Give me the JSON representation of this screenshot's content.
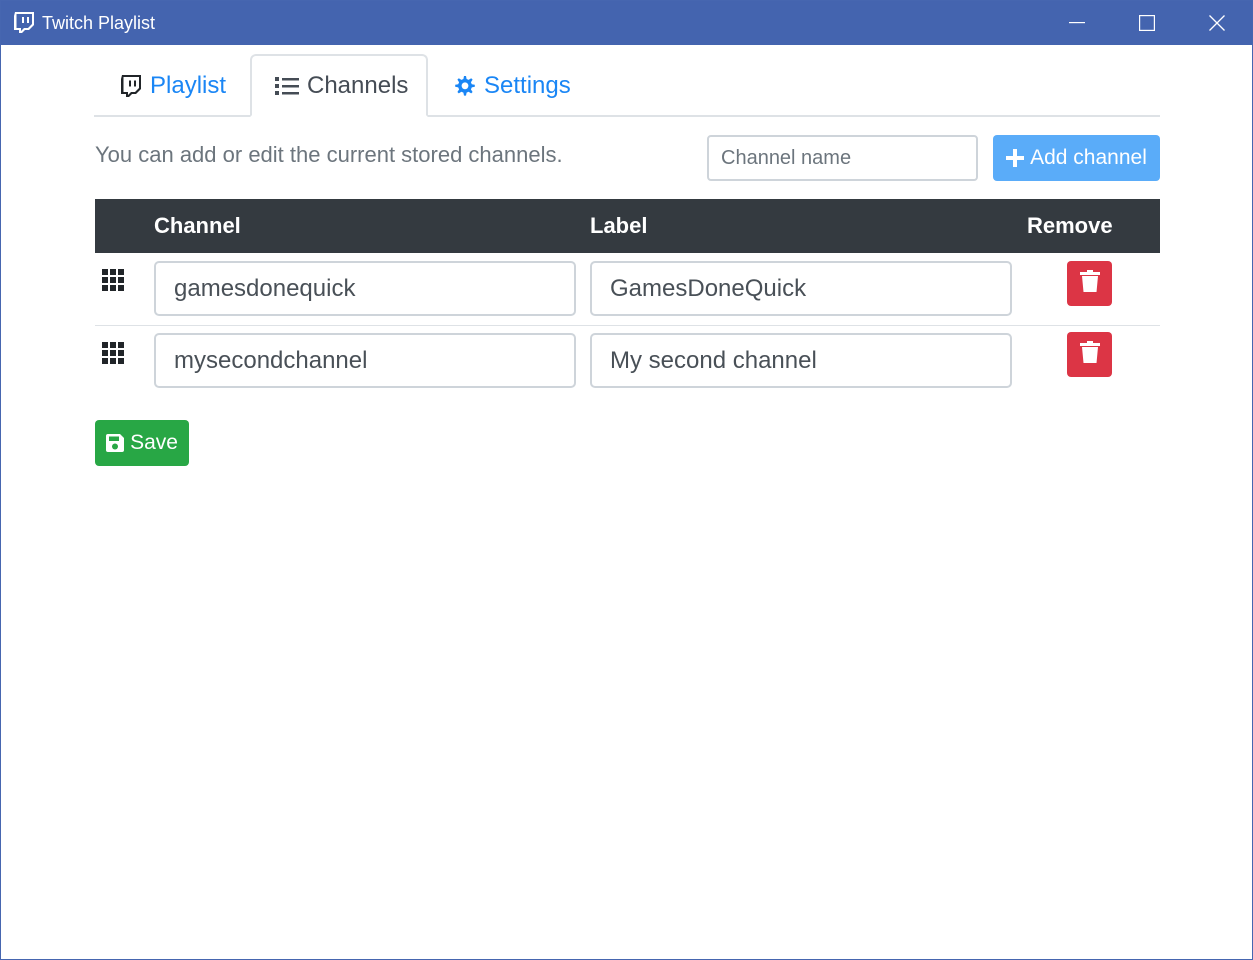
{
  "window": {
    "title": "Twitch Playlist",
    "icons": {
      "app": "twitch-icon",
      "minimize": "minimize-icon",
      "maximize": "maximize-icon",
      "close": "close-icon"
    }
  },
  "tabs": [
    {
      "label": "Playlist",
      "icon": "twitch-icon",
      "active": false
    },
    {
      "label": "Channels",
      "icon": "list-icon",
      "active": true
    },
    {
      "label": "Settings",
      "icon": "gear-icon",
      "active": false
    }
  ],
  "intro_text": "You can add or edit the current stored channels.",
  "channel_input": {
    "placeholder": "Channel name",
    "value": ""
  },
  "add_button": {
    "label": "Add channel",
    "icon": "plus-icon"
  },
  "table": {
    "headers": {
      "channel": "Channel",
      "label": "Label",
      "remove": "Remove"
    },
    "rows": [
      {
        "channel": "gamesdonequick",
        "label": "GamesDoneQuick"
      },
      {
        "channel": "mysecondchannel",
        "label": "My second channel"
      }
    ],
    "row_icons": {
      "drag": "grip-icon",
      "remove": "trash-icon"
    }
  },
  "save_button": {
    "label": "Save",
    "icon": "floppy-disk-icon"
  },
  "colors": {
    "titlebar": "#4464af",
    "link": "#1a86f5",
    "table_header": "#343a40",
    "add_button": "#5aacf9",
    "delete_button": "#dc3545",
    "save_button": "#28a745"
  }
}
